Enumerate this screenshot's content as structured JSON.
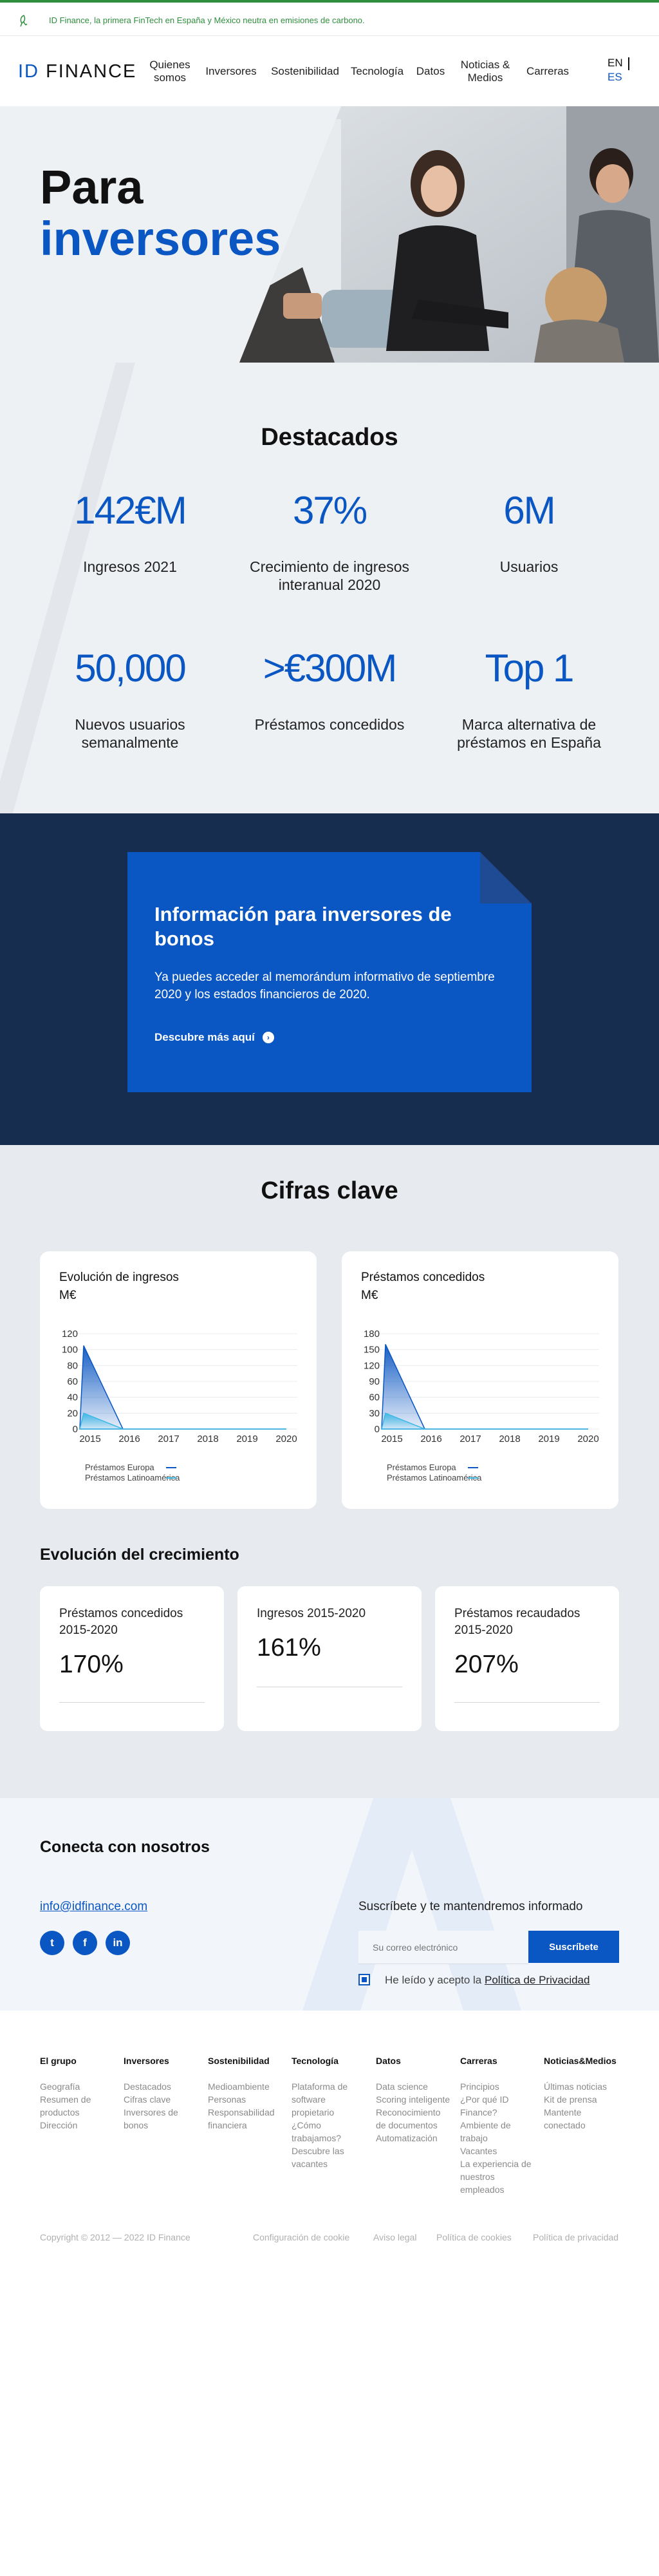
{
  "notice": {
    "text": "ID Finance, la primera FinTech en España y México neutra en emisiones de carbono."
  },
  "header": {
    "logo": {
      "id": "ID",
      "name": "FINANCE"
    },
    "nav": [
      {
        "label": "Quienes somos"
      },
      {
        "label": "Inversores"
      },
      {
        "label": "Sostenibilidad"
      },
      {
        "label": "Tecnología"
      },
      {
        "label": "Datos"
      },
      {
        "label": "Noticias & Medios"
      },
      {
        "label": "Carreras"
      }
    ],
    "lang": {
      "en": "EN",
      "es": "ES"
    }
  },
  "hero": {
    "line1": "Para",
    "line2": "inversores"
  },
  "highlights": {
    "title": "Destacados",
    "stats": [
      {
        "value": "142€M",
        "label": "Ingresos 2021"
      },
      {
        "value": "37%",
        "label": "Crecimiento de ingresos interanual 2020"
      },
      {
        "value": "6M",
        "label": "Usuarios"
      },
      {
        "value": "50,000",
        "label": "Nuevos usuarios semanalmente"
      },
      {
        "value": ">€300M",
        "label": "Préstamos concedidos"
      },
      {
        "value": "Top 1",
        "label": "Marca alternativa de préstamos en España"
      }
    ]
  },
  "investors": {
    "title": "Información para inversores de bonos",
    "text": "Ya puedes acceder al memorándum informativo de septiembre 2020 y los estados financieros de 2020.",
    "cta": "Descubre más aquí"
  },
  "keyfigures": {
    "title": "Cifras clave",
    "growth_title": "Evolución del crecimiento",
    "growth": [
      {
        "label": "Préstamos concedidos 2015-2020",
        "value": "170%"
      },
      {
        "label": "Ingresos 2015-2020",
        "value": "161%"
      },
      {
        "label": "Préstamos recaudados 2015-2020",
        "value": "207%"
      }
    ]
  },
  "chart_data": [
    {
      "type": "area",
      "title": "Evolución de ingresos",
      "unit": "M€",
      "x": [
        "2015",
        "2016",
        "2017",
        "2018",
        "2019",
        "2020"
      ],
      "ylim": [
        0,
        120
      ],
      "yticks": [
        "120",
        "100",
        "80",
        "60",
        "40",
        "20",
        "0"
      ],
      "series": [
        {
          "name": "Préstamos Europa",
          "color": "#0a56c2",
          "values": [
            105,
            0,
            0,
            0,
            0,
            0
          ]
        },
        {
          "name": "Préstamos Latinoamérica",
          "color": "#3cb8e6",
          "values": [
            20,
            0,
            0,
            0,
            0,
            0
          ]
        }
      ]
    },
    {
      "type": "area",
      "title": "Préstamos concedidos",
      "unit": "M€",
      "x": [
        "2015",
        "2016",
        "2017",
        "2018",
        "2019",
        "2020"
      ],
      "ylim": [
        0,
        180
      ],
      "yticks": [
        "180",
        "150",
        "120",
        "90",
        "60",
        "30",
        "0"
      ],
      "series": [
        {
          "name": "Préstamos Europa",
          "color": "#0a56c2",
          "values": [
            160,
            0,
            0,
            0,
            0,
            0
          ]
        },
        {
          "name": "Préstamos Latinoamérica",
          "color": "#3cb8e6",
          "values": [
            30,
            0,
            0,
            0,
            0,
            0
          ]
        }
      ]
    }
  ],
  "connect": {
    "title": "Conecta con nosotros",
    "email": "info@idfinance.com",
    "social": [
      {
        "icon": "twitter-icon",
        "glyph": "t"
      },
      {
        "icon": "facebook-icon",
        "glyph": "f"
      },
      {
        "icon": "linkedin-icon",
        "glyph": "in"
      }
    ],
    "subscribe_title": "Suscríbete y te mantendremos informado",
    "email_placeholder": "Su correo electrónico",
    "subscribe_button": "Suscríbete",
    "privacy_prefix": "He leído y acepto la ",
    "privacy_link": "Política de Privacidad"
  },
  "footer": {
    "columns": [
      {
        "title": "El grupo",
        "links": [
          "Geografía",
          "Resumen de productos",
          "Dirección"
        ]
      },
      {
        "title": "Inversores",
        "links": [
          "Destacados",
          "Cifras clave",
          "Inversores de bonos"
        ]
      },
      {
        "title": "Sostenibilidad",
        "links": [
          "Medioambiente",
          "Personas",
          "Responsabilidad financiera"
        ]
      },
      {
        "title": "Tecnología",
        "links": [
          "Plataforma de software propietario",
          "¿Cómo trabajamos?",
          "Descubre las vacantes"
        ]
      },
      {
        "title": "Datos",
        "links": [
          "Data science",
          "Scoring inteligente",
          "Reconocimiento de documentos",
          "Automatización"
        ]
      },
      {
        "title": "Carreras",
        "links": [
          "Principios",
          "¿Por qué ID Finance?",
          "Ambiente de trabajo",
          "Vacantes",
          "La experiencia de nuestros empleados"
        ]
      },
      {
        "title": "Noticias&Medios",
        "links": [
          "Últimas noticias",
          "Kit de prensa",
          "Mantente conectado"
        ]
      }
    ],
    "copyright": "Copyright © 2012 — 2022 ID Finance",
    "bottom_links": [
      "Configuración de cookie",
      "Aviso legal",
      "Política de cookies",
      "Política de privacidad"
    ]
  }
}
